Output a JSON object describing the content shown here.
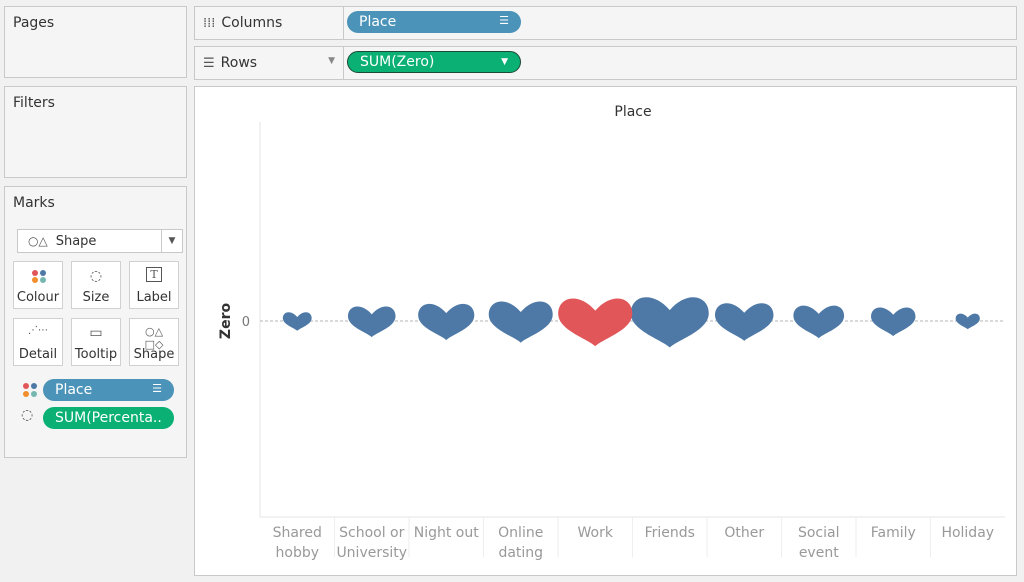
{
  "sidebar": {
    "pages_title": "Pages",
    "filters_title": "Filters",
    "marks_title": "Marks",
    "mark_type": "Shape",
    "buttons": {
      "colour": "Colour",
      "size": "Size",
      "label": "Label",
      "detail": "Detail",
      "tooltip": "Tooltip",
      "shape": "Shape"
    },
    "pills": [
      {
        "label": "Place",
        "encoding": "colour"
      },
      {
        "label": "SUM(Percenta..",
        "encoding": "size"
      }
    ]
  },
  "shelves": {
    "columns_label": "Columns",
    "columns_pill": "Place",
    "rows_label": "Rows",
    "rows_pill": "SUM(Zero)"
  },
  "colors": {
    "blue_pill": "#4b93b8",
    "green_pill": "#0ab074",
    "heart_blue": "#4e79a7",
    "heart_red": "#e15759"
  },
  "chart_data": {
    "type": "scatter",
    "mark_shape": "heart",
    "title": "Place",
    "ylabel": "Zero",
    "y_ticks": [
      "0"
    ],
    "categories": [
      "Shared hobby",
      "School or University",
      "Night out",
      "Online dating",
      "Work",
      "Friends",
      "Other",
      "Social event",
      "Family",
      "Holiday"
    ],
    "x_label_lines": [
      [
        "Shared",
        "hobby"
      ],
      [
        "School or",
        "University"
      ],
      [
        "Night out"
      ],
      [
        "Online",
        "dating"
      ],
      [
        "Work"
      ],
      [
        "Friends"
      ],
      [
        "Other"
      ],
      [
        "Social",
        "event"
      ],
      [
        "Family"
      ],
      [
        "Holiday"
      ]
    ],
    "y_values": [
      0,
      0,
      0,
      0,
      0,
      0,
      0,
      0,
      0,
      0
    ],
    "relative_size": [
      0.37,
      0.61,
      0.72,
      0.82,
      0.95,
      1.0,
      0.75,
      0.65,
      0.57,
      0.31
    ],
    "highlight": "Work",
    "series": [
      {
        "name": "",
        "values": [
          0,
          0,
          0,
          0,
          0,
          0,
          0,
          0,
          0,
          0
        ]
      }
    ]
  }
}
